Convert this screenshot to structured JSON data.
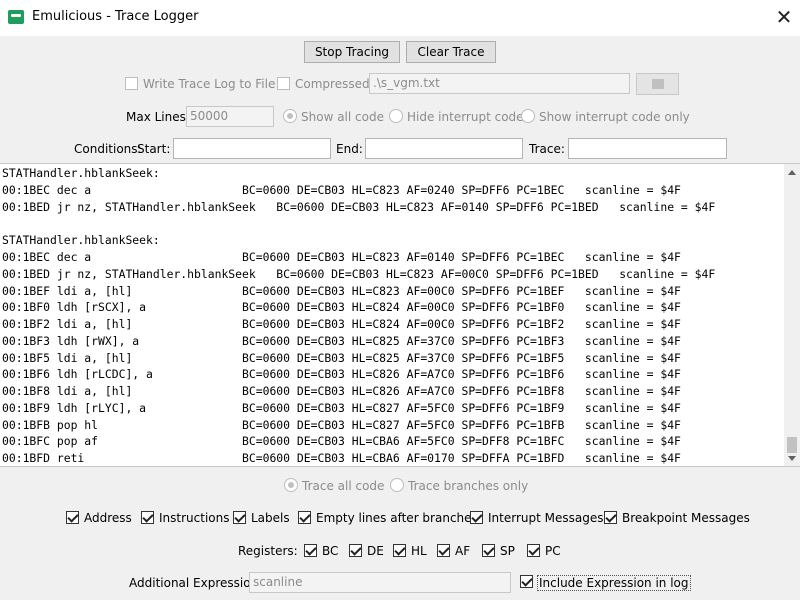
{
  "window": {
    "title": "Emulicious - Trace Logger",
    "close_glyph": "✕"
  },
  "toolbar": {
    "stop_label": "Stop Tracing",
    "clear_label": "Clear Trace"
  },
  "file": {
    "write_label": "Write Trace Log to File",
    "compressed_label": "Compressed",
    "path_value": ".\\s_vgm.txt"
  },
  "maxlines": {
    "label": "Max Lines:",
    "value": "50000",
    "show_all": "Show all code",
    "hide_interrupt": "Hide interrupt code",
    "show_interrupt_only": "Show interrupt code only"
  },
  "conditions": {
    "label": "Conditions:",
    "start_label": "Start:",
    "end_label": "End:",
    "trace_label": "Trace:"
  },
  "log": {
    "lines": [
      {
        "text": "STATHandler.hblankSeek:"
      },
      {
        "text": "00:1BEC dec a                      BC=0600 DE=CB03 HL=C823 AF=0240 SP=DFF6 PC=1BEC   scanline = $4F"
      },
      {
        "text": "00:1BED jr nz, STATHandler.hblankSeek   BC=0600 DE=CB03 HL=C823 AF=0140 SP=DFF6 PC=1BED   scanline = $4F"
      },
      {
        "text": ""
      },
      {
        "text": "STATHandler.hblankSeek:"
      },
      {
        "text": "00:1BEC dec a                      BC=0600 DE=CB03 HL=C823 AF=0140 SP=DFF6 PC=1BEC   scanline = $4F"
      },
      {
        "text": "00:1BED jr nz, STATHandler.hblankSeek   BC=0600 DE=CB03 HL=C823 AF=00C0 SP=DFF6 PC=1BED   scanline = $4F"
      },
      {
        "text": "00:1BEF ldi a, [hl]                BC=0600 DE=CB03 HL=C823 AF=00C0 SP=DFF6 PC=1BEF   scanline = $4F"
      },
      {
        "text": "00:1BF0 ldh [rSCX], a              BC=0600 DE=CB03 HL=C824 AF=00C0 SP=DFF6 PC=1BF0   scanline = $4F"
      },
      {
        "text": "00:1BF2 ldi a, [hl]                BC=0600 DE=CB03 HL=C824 AF=00C0 SP=DFF6 PC=1BF2   scanline = $4F"
      },
      {
        "text": "00:1BF3 ldh [rWX], a               BC=0600 DE=CB03 HL=C825 AF=37C0 SP=DFF6 PC=1BF3   scanline = $4F"
      },
      {
        "text": "00:1BF5 ldi a, [hl]                BC=0600 DE=CB03 HL=C825 AF=37C0 SP=DFF6 PC=1BF5   scanline = $4F"
      },
      {
        "text": "00:1BF6 ldh [rLCDC], a             BC=0600 DE=CB03 HL=C826 AF=A7C0 SP=DFF6 PC=1BF6   scanline = $4F"
      },
      {
        "text": "00:1BF8 ldi a, [hl]                BC=0600 DE=CB03 HL=C826 AF=A7C0 SP=DFF6 PC=1BF8   scanline = $4F"
      },
      {
        "text": "00:1BF9 ldh [rLYC], a              BC=0600 DE=CB03 HL=C827 AF=5FC0 SP=DFF6 PC=1BF9   scanline = $4F"
      },
      {
        "text": "00:1BFB pop hl                     BC=0600 DE=CB03 HL=C827 AF=5FC0 SP=DFF6 PC=1BFB   scanline = $4F"
      },
      {
        "text": "00:1BFC pop af                     BC=0600 DE=CB03 HL=CBA6 AF=5FC0 SP=DFF8 PC=1BFC   scanline = $4F"
      },
      {
        "text": "00:1BFD reti                       BC=0600 DE=CB03 HL=CBA6 AF=0170 SP=DFFA PC=1BFD   scanline = $4F"
      }
    ]
  },
  "trace_mode": {
    "all_label": "Trace all code",
    "branches_label": "Trace branches only"
  },
  "options": {
    "address": "Address",
    "instructions": "Instructions",
    "labels": "Labels",
    "empty_lines": "Empty lines after branches",
    "interrupt": "Interrupt Messages",
    "breakpoint": "Breakpoint Messages"
  },
  "registers": {
    "label": "Registers:",
    "bc": "BC",
    "de": "DE",
    "hl": "HL",
    "af": "AF",
    "sp": "SP",
    "pc": "PC"
  },
  "expression": {
    "label": "Additional Expression:",
    "value": "scanline",
    "include_label": "Include Expression in log"
  }
}
